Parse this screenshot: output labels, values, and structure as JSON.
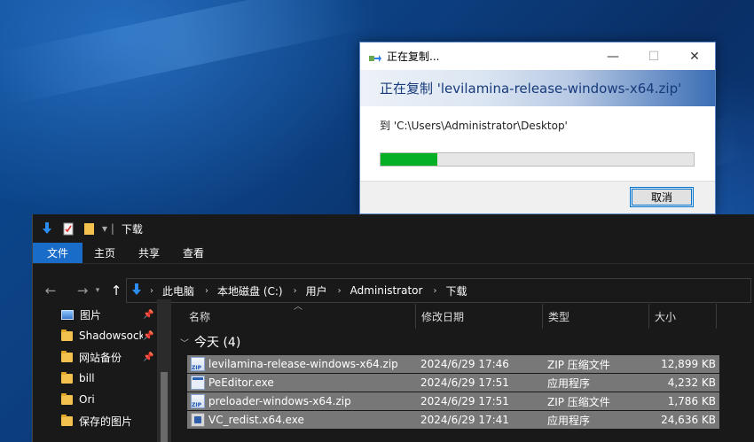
{
  "copy_dialog": {
    "title": "正在复制...",
    "banner": "正在复制 'levilamina-release-windows-x64.zip'",
    "destination": "到 'C:\\Users\\Administrator\\Desktop'",
    "progress": 0.18,
    "progress_color": "#06b025",
    "cancel_label": "取消",
    "minimize_glyph": "—",
    "maximize_glyph": "☐",
    "close_glyph": "✕"
  },
  "explorer": {
    "title": "下载",
    "ribbon_tabs": [
      "文件",
      "主页",
      "共享",
      "查看"
    ],
    "breadcrumb": [
      "此电脑",
      "本地磁盘 (C:)",
      "用户",
      "Administrator",
      "下载"
    ],
    "nav_items": [
      {
        "label": "图片",
        "icon": "pictures-icon",
        "pinned": true
      },
      {
        "label": "Shadowsock",
        "icon": "folder-icon",
        "pinned": true
      },
      {
        "label": "网站备份",
        "icon": "folder-icon",
        "pinned": true
      },
      {
        "label": "bill",
        "icon": "folder-icon",
        "pinned": false
      },
      {
        "label": "Ori",
        "icon": "folder-icon",
        "pinned": false
      },
      {
        "label": "保存的图片",
        "icon": "folder-icon",
        "pinned": false
      }
    ],
    "columns": {
      "name": "名称",
      "date": "修改日期",
      "type": "类型",
      "size": "大小"
    },
    "group": "今天 (4)",
    "files": [
      {
        "name": "levilamina-release-windows-x64.zip",
        "date": "2024/6/29 17:46",
        "type": "ZIP 压缩文件",
        "size": "12,899 KB",
        "icon": "zip-icon"
      },
      {
        "name": "PeEditor.exe",
        "date": "2024/6/29 17:51",
        "type": "应用程序",
        "size": "4,232 KB",
        "icon": "exe-icon"
      },
      {
        "name": "preloader-windows-x64.zip",
        "date": "2024/6/29 17:51",
        "type": "ZIP 压缩文件",
        "size": "1,786 KB",
        "icon": "zip-icon"
      },
      {
        "name": "VC_redist.x64.exe",
        "date": "2024/6/29 17:41",
        "type": "应用程序",
        "size": "24,636 KB",
        "icon": "vc-installer-icon"
      }
    ],
    "accent_color": "#1a6cc9"
  }
}
